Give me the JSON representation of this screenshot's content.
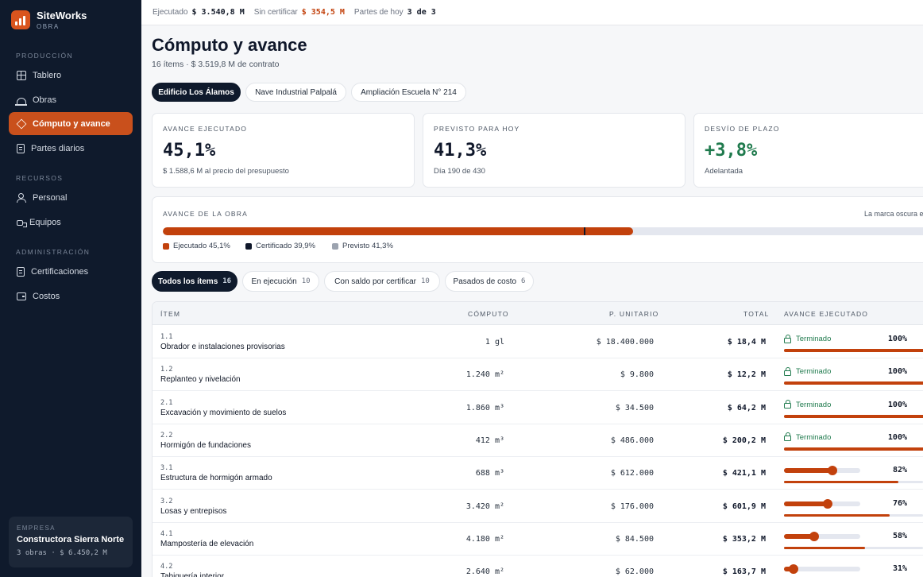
{
  "brand": {
    "name": "SiteWorks",
    "sub": "OBRA"
  },
  "sidebar": {
    "sections": [
      "PRODUCCIÓN",
      "RECURSOS",
      "ADMINISTRACIÓN"
    ],
    "items": [
      {
        "label": "Tablero",
        "icon": "grid-icon"
      },
      {
        "label": "Obras",
        "icon": "helmet-icon"
      },
      {
        "label": "Cómputo y avance",
        "icon": "layers-icon",
        "active": true
      },
      {
        "label": "Partes diarios",
        "icon": "document-icon"
      },
      {
        "label": "Personal",
        "icon": "user-icon"
      },
      {
        "label": "Equipos",
        "icon": "truck-icon"
      },
      {
        "label": "Certificaciones",
        "icon": "certificate-icon"
      },
      {
        "label": "Costos",
        "icon": "wallet-icon"
      }
    ],
    "company": {
      "label": "EMPRESA",
      "name": "Constructora Sierra Norte",
      "meta": "3 obras · $ 6.450,2 M"
    }
  },
  "topbar": {
    "executed_label": "Ejecutado",
    "executed_value": "$ 3.540,8 M",
    "uncertified_label": "Sin certificar",
    "uncertified_value": "$ 354,5 M",
    "today_label": "Partes de hoy",
    "today_value": "3 de 3"
  },
  "page": {
    "title": "Cómputo y avance",
    "subtitle": "16 ítems · $ 3.519,8 M de contrato",
    "projects": [
      "Edificio Los Álamos",
      "Nave Industrial Palpalá",
      "Ampliación Escuela N° 214"
    ]
  },
  "kpis": [
    {
      "label": "AVANCE EJECUTADO",
      "value": "45,1%",
      "foot": "$ 1.588,6 M al precio del presupuesto"
    },
    {
      "label": "PREVISTO PARA HOY",
      "value": "41,3%",
      "foot": "Día 190 de 430"
    },
    {
      "label": "DESVÍO DE PLAZO",
      "value": "+3,8%",
      "foot": "Adelantada",
      "color": "#1f7a4d"
    }
  ],
  "progress": {
    "label": "AVANCE DE LA OBRA",
    "note": "La marca oscura es",
    "executed_pct": 45.1,
    "certified_pct": 39.9,
    "planned_pct": 41.3,
    "legend": [
      "Ejecutado 45,1%",
      "Certificado 39,9%",
      "Previsto 41,3%"
    ],
    "colors": {
      "executed": "#c2410c",
      "certified": "#0f172a",
      "planned": "#9ca3af"
    }
  },
  "filters": [
    {
      "label": "Todos los ítems",
      "count": "16"
    },
    {
      "label": "En ejecución",
      "count": "10"
    },
    {
      "label": "Con saldo por certificar",
      "count": "10"
    },
    {
      "label": "Pasados de costo",
      "count": "6"
    }
  ],
  "table": {
    "headers": {
      "item": "ÍTEM",
      "computo": "CÓMPUTO",
      "unit_price": "P. UNITARIO",
      "total": "TOTAL",
      "progress": "AVANCE EJECUTADO"
    },
    "done_label": "Terminado",
    "rows": [
      {
        "code": "1.1",
        "name": "Obrador e instalaciones provisorias",
        "computo": "1 gl",
        "unit_price": "$ 18.400.000",
        "total": "$ 18,4 M",
        "pct": "100%",
        "value": 100,
        "done": true
      },
      {
        "code": "1.2",
        "name": "Replanteo y nivelación",
        "computo": "1.240 m²",
        "unit_price": "$ 9.800",
        "total": "$ 12,2 M",
        "pct": "100%",
        "value": 100,
        "done": true
      },
      {
        "code": "2.1",
        "name": "Excavación y movimiento de suelos",
        "computo": "1.860 m³",
        "unit_price": "$ 34.500",
        "total": "$ 64,2 M",
        "pct": "100%",
        "value": 100,
        "done": true
      },
      {
        "code": "2.2",
        "name": "Hormigón de fundaciones",
        "computo": "412 m³",
        "unit_price": "$ 486.000",
        "total": "$ 200,2 M",
        "pct": "100%",
        "value": 100,
        "done": true
      },
      {
        "code": "3.1",
        "name": "Estructura de hormigón armado",
        "computo": "688 m³",
        "unit_price": "$ 612.000",
        "total": "$ 421,1 M",
        "pct": "82%",
        "value": 82,
        "done": false
      },
      {
        "code": "3.2",
        "name": "Losas y entrepisos",
        "computo": "3.420 m²",
        "unit_price": "$ 176.000",
        "total": "$ 601,9 M",
        "pct": "76%",
        "value": 76,
        "done": false
      },
      {
        "code": "4.1",
        "name": "Mampostería de elevación",
        "computo": "4.180 m²",
        "unit_price": "$ 84.500",
        "total": "$ 353,2 M",
        "pct": "58%",
        "value": 58,
        "done": false
      },
      {
        "code": "4.2",
        "name": "Tabiquería interior",
        "computo": "2.640 m²",
        "unit_price": "$ 62.000",
        "total": "$ 163,7 M",
        "pct": "31%",
        "value": 31,
        "done": false
      }
    ]
  }
}
